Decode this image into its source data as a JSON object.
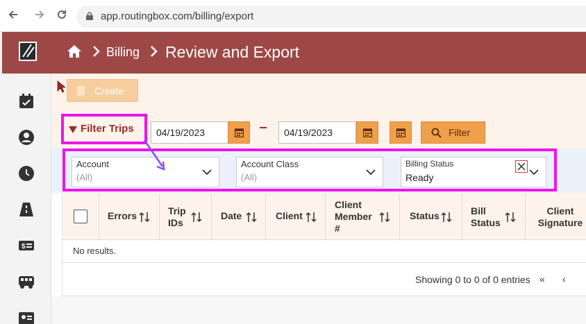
{
  "browser": {
    "url": "app.routingbox.com/billing/export",
    "back_icon": "arrow-left-icon",
    "forward_icon": "arrow-right-icon",
    "reload_icon": "reload-icon"
  },
  "header": {
    "breadcrumb_1": "Billing",
    "breadcrumb_2": "Review and Export"
  },
  "toolbar": {
    "create_label": "Create"
  },
  "filters": {
    "title": "Filter Trips",
    "start_date": "04/19/2023",
    "end_date": "04/19/2023",
    "dash": "–",
    "filter_label": "Filter"
  },
  "selects": {
    "account": {
      "label": "Account",
      "value": "(All)"
    },
    "account_class": {
      "label": "Account Class",
      "value": "(All)"
    },
    "billing_status": {
      "label": "Billing Status",
      "value": "Ready"
    }
  },
  "table": {
    "columns": [
      "Errors",
      "Trip IDs",
      "Date",
      "Client",
      "Client Member #",
      "Status",
      "Bill Status",
      "Client Signature"
    ],
    "empty_text": "No results.",
    "showing_text": "Showing 0 to 0 of 0 entries",
    "pager_first": "«",
    "pager_prev": "‹"
  },
  "colors": {
    "brand": "#9e4747",
    "accent": "#f0a04b",
    "highlight": "#ee14ee"
  }
}
